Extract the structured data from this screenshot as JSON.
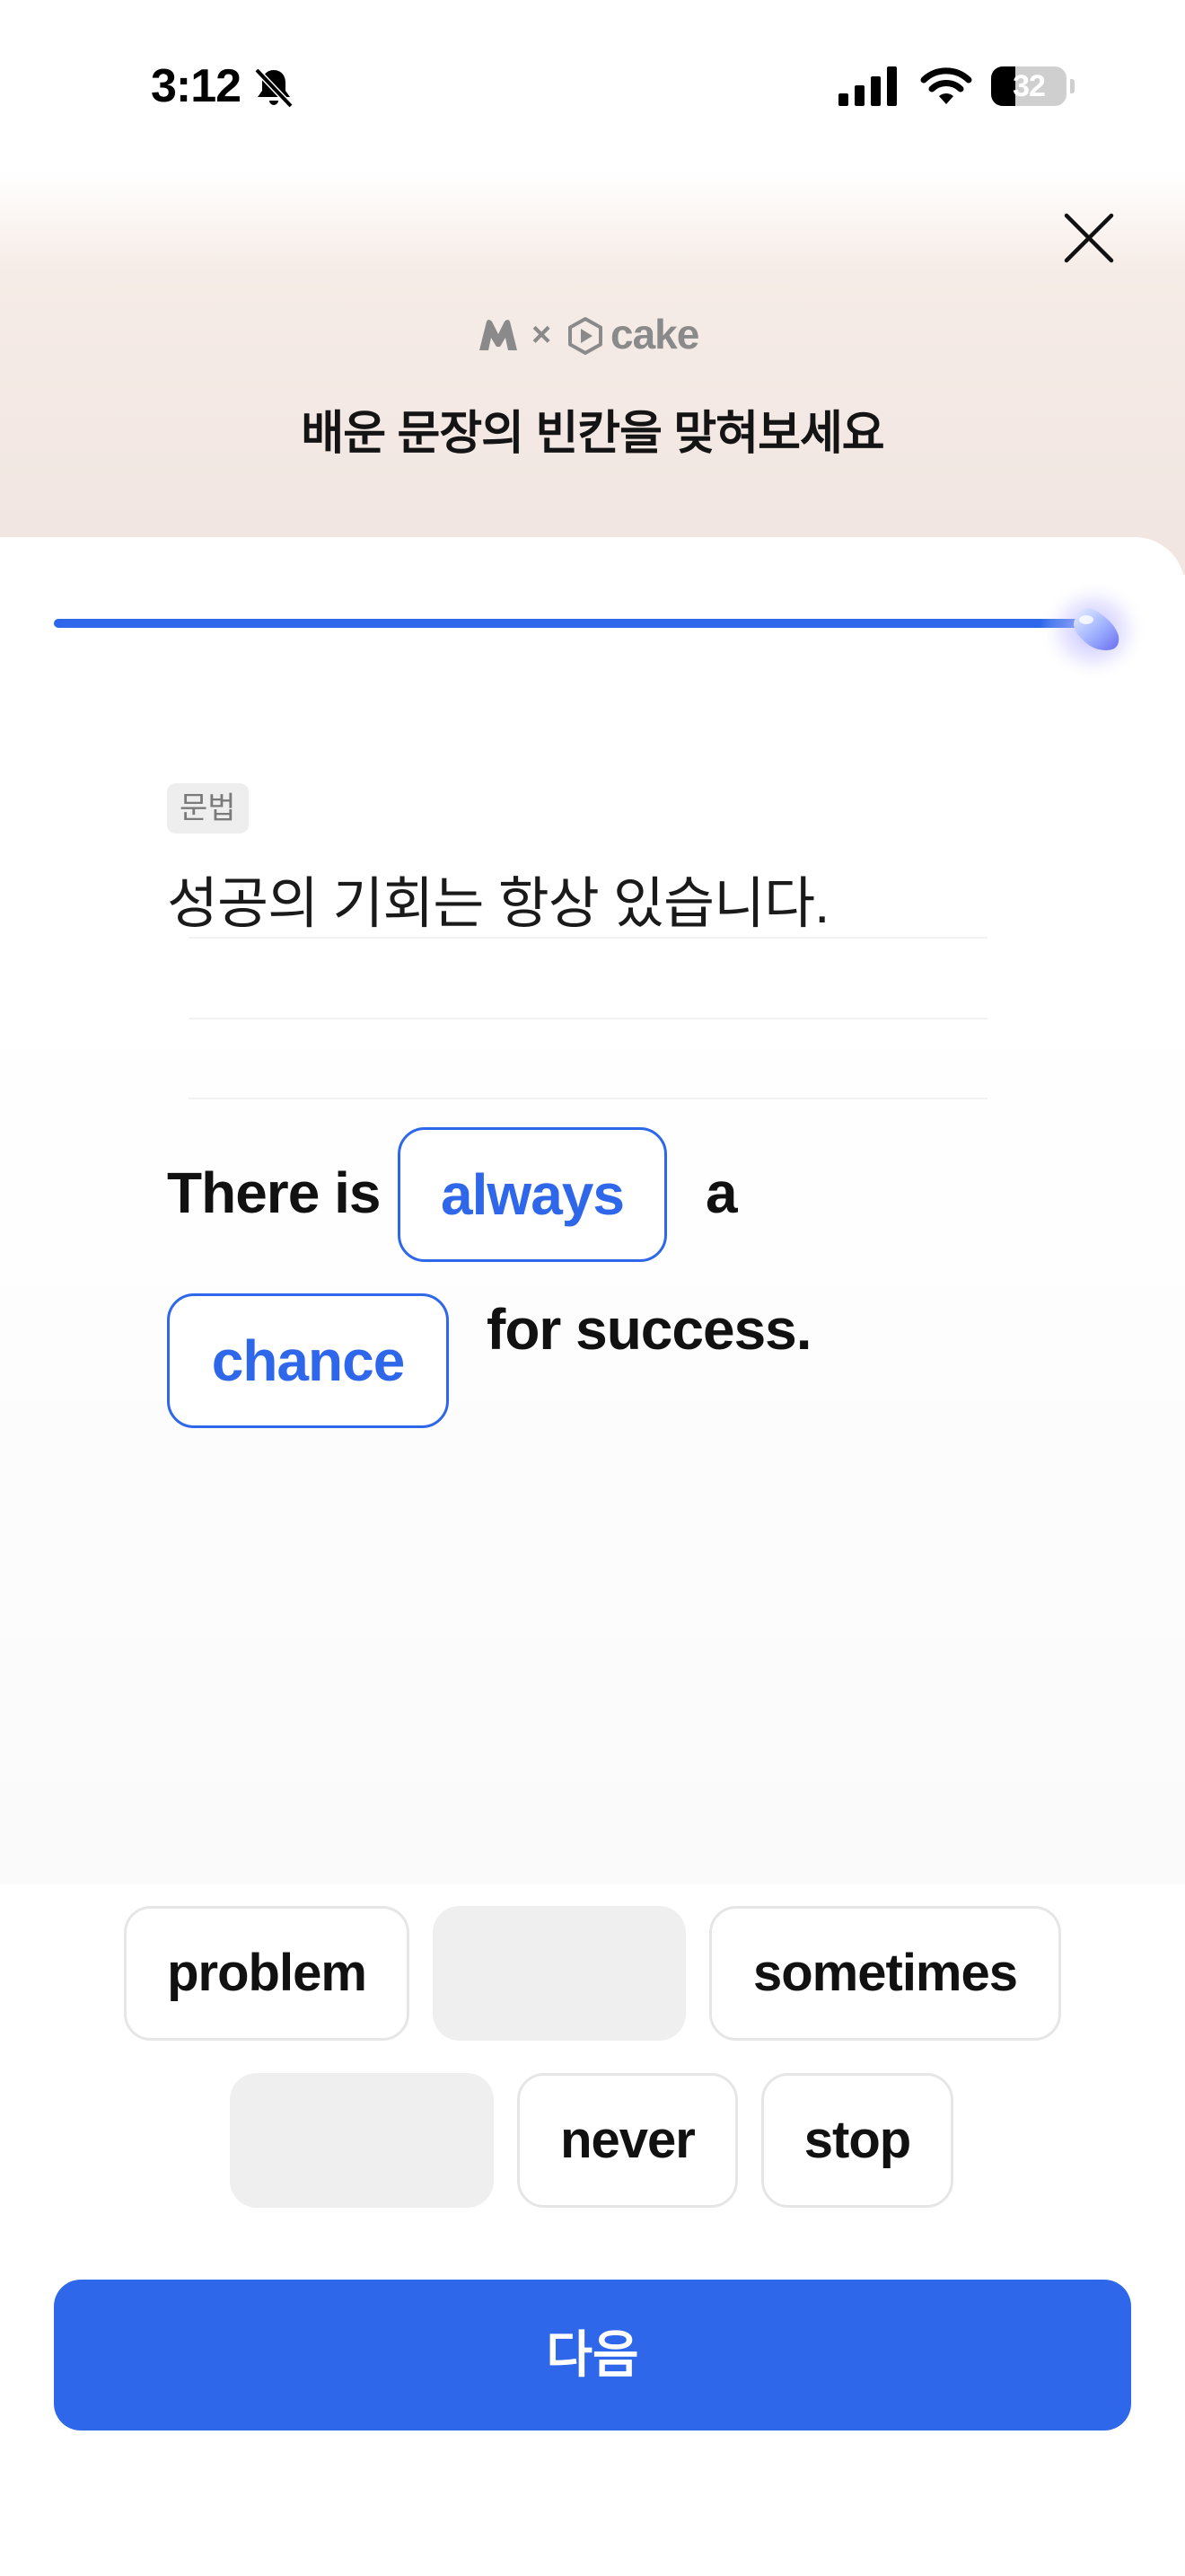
{
  "status_bar": {
    "time": "3:12",
    "battery_level": "32",
    "battery_fraction": 0.32
  },
  "header": {
    "brand_x": "×",
    "brand_name": "cake",
    "instruction": "배운 문장의 빈칸을 맞혀보세요"
  },
  "progress": {
    "fraction": 1.0
  },
  "question": {
    "badge": "문법",
    "korean": "성공의 기회는 항상 있습니다.",
    "words": [
      "There is",
      "a",
      "for success."
    ],
    "blanks": [
      "always",
      "chance"
    ]
  },
  "options": [
    "problem",
    "sometimes",
    "never",
    "stop"
  ],
  "next_label": "다음",
  "colors": {
    "accent": "#2e67ea",
    "chip_border": "#e6e6e6",
    "empty_slot": "#efefef"
  },
  "icons": [
    "bell-off-icon",
    "signal-icon",
    "wifi-icon",
    "battery-icon",
    "close-icon",
    "brand-logo-icon",
    "cake-logo-icon",
    "progress-knob-icon"
  ]
}
